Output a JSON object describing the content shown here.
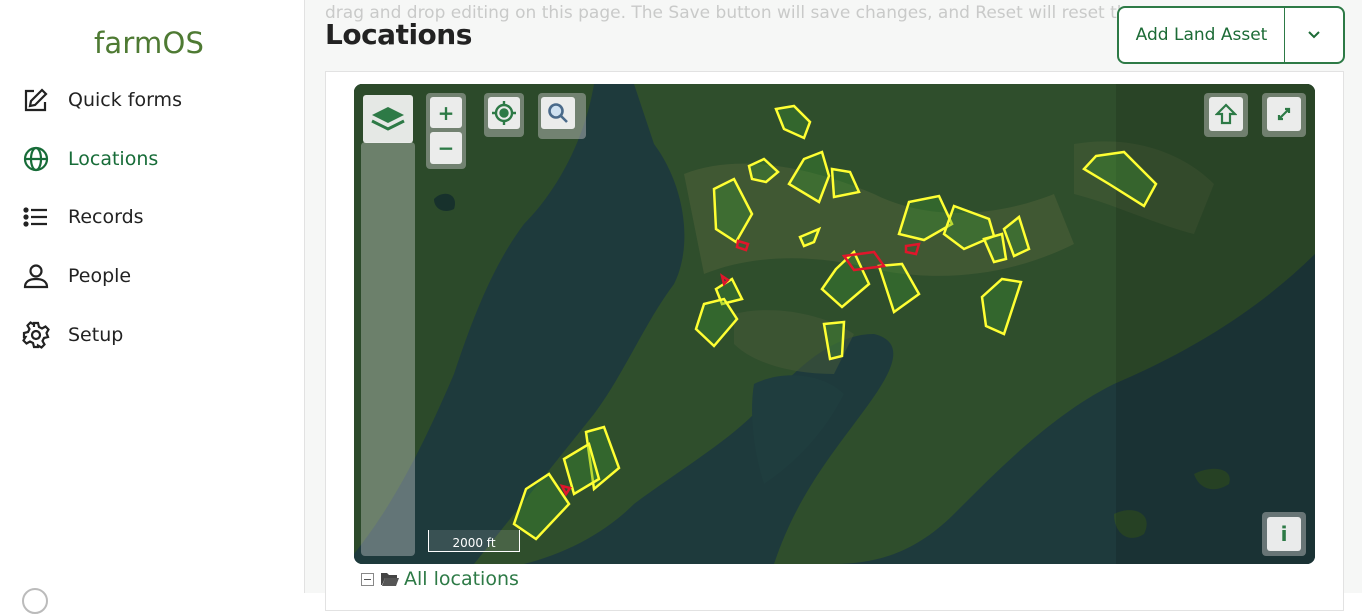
{
  "app": {
    "logo": "farmOS"
  },
  "sidebar": {
    "items": [
      {
        "label": "Quick forms",
        "icon": "edit-icon"
      },
      {
        "label": "Locations",
        "icon": "globe-icon",
        "active": true
      },
      {
        "label": "Records",
        "icon": "list-icon"
      },
      {
        "label": "People",
        "icon": "person-icon"
      },
      {
        "label": "Setup",
        "icon": "gear-icon"
      }
    ]
  },
  "page": {
    "title": "Locations",
    "faded_text": "drag and drop editing on this page. The Save button will save changes, and Reset will reset them."
  },
  "toolbar": {
    "add_label": "Add Land Asset"
  },
  "map": {
    "zoom_in": "+",
    "zoom_out": "−",
    "info": "i",
    "scale": "2000 ft",
    "colors": {
      "field_outline": "#ffff33",
      "highlight": "#e0162b",
      "accent": "#2d7a46"
    }
  },
  "tree": {
    "root_label": "All locations"
  }
}
